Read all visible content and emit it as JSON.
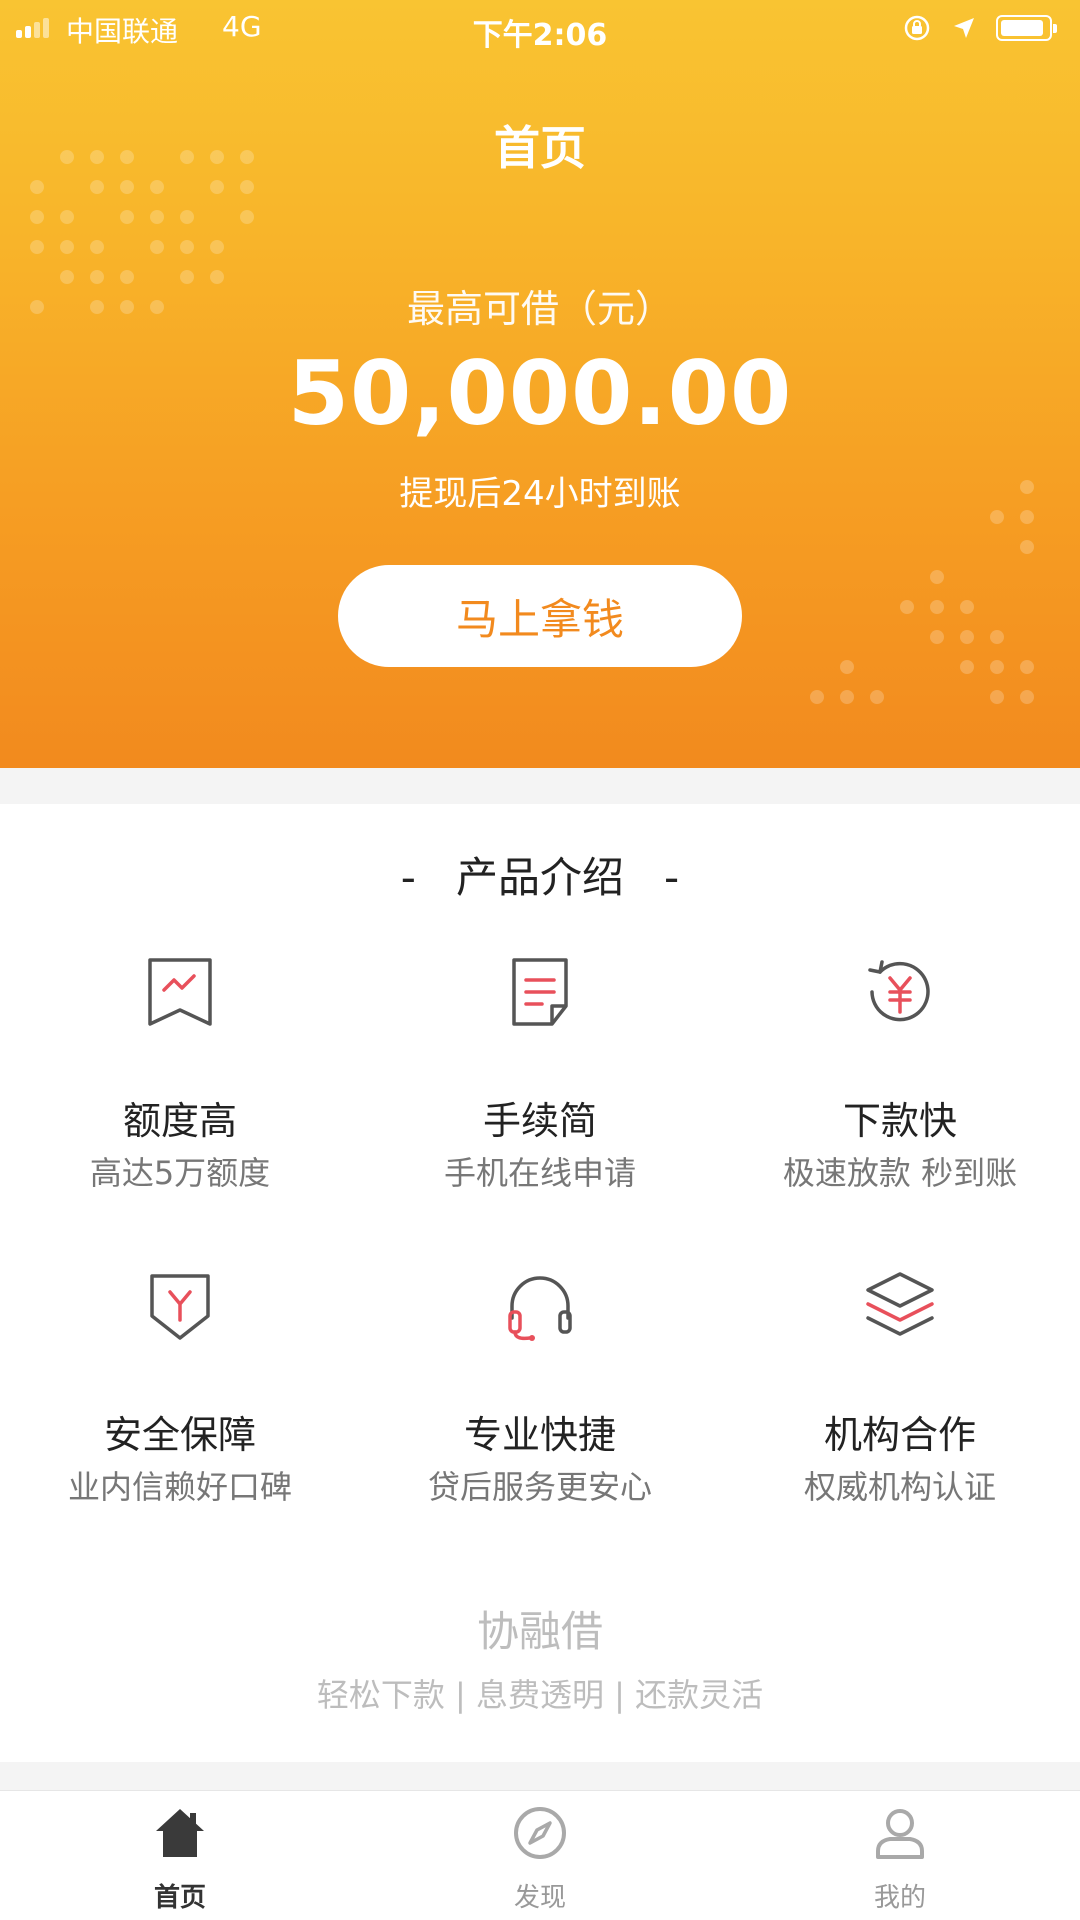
{
  "status_bar": {
    "carrier": "中国联通",
    "network": "4G",
    "time": "下午2:06"
  },
  "header": {
    "title": "首页"
  },
  "loan": {
    "max_label": "最高可借（元）",
    "amount": "50,000.00",
    "arrival_note": "提现后24小时到账",
    "cta_label": "马上拿钱"
  },
  "intro": {
    "title": "-   产品介绍   -",
    "features": [
      {
        "name": "额度高",
        "desc": "高达5万额度",
        "icon": "trend-chart-icon"
      },
      {
        "name": "手续简",
        "desc": "手机在线申请",
        "icon": "document-icon"
      },
      {
        "name": "下款快",
        "desc": "极速放款 秒到账",
        "icon": "yuan-refresh-icon"
      },
      {
        "name": "安全保障",
        "desc": "业内信赖好口碑",
        "icon": "shield-icon"
      },
      {
        "name": "专业快捷",
        "desc": "贷后服务更安心",
        "icon": "headset-icon"
      },
      {
        "name": "机构合作",
        "desc": "权威机构认证",
        "icon": "layers-icon"
      }
    ]
  },
  "brand": {
    "name": "协融借",
    "tagline": "轻松下款 | 息费透明 | 还款灵活"
  },
  "tabbar": {
    "tabs": [
      {
        "label": "首页",
        "icon": "home-icon",
        "active": true
      },
      {
        "label": "发现",
        "icon": "compass-icon",
        "active": false
      },
      {
        "label": "我的",
        "icon": "user-icon",
        "active": false
      }
    ]
  },
  "colors": {
    "hero_top": "#f9c432",
    "hero_bottom": "#f28a1e",
    "accent": "#f28a1e",
    "icon_red": "#e8505b",
    "icon_gray": "#555555"
  }
}
